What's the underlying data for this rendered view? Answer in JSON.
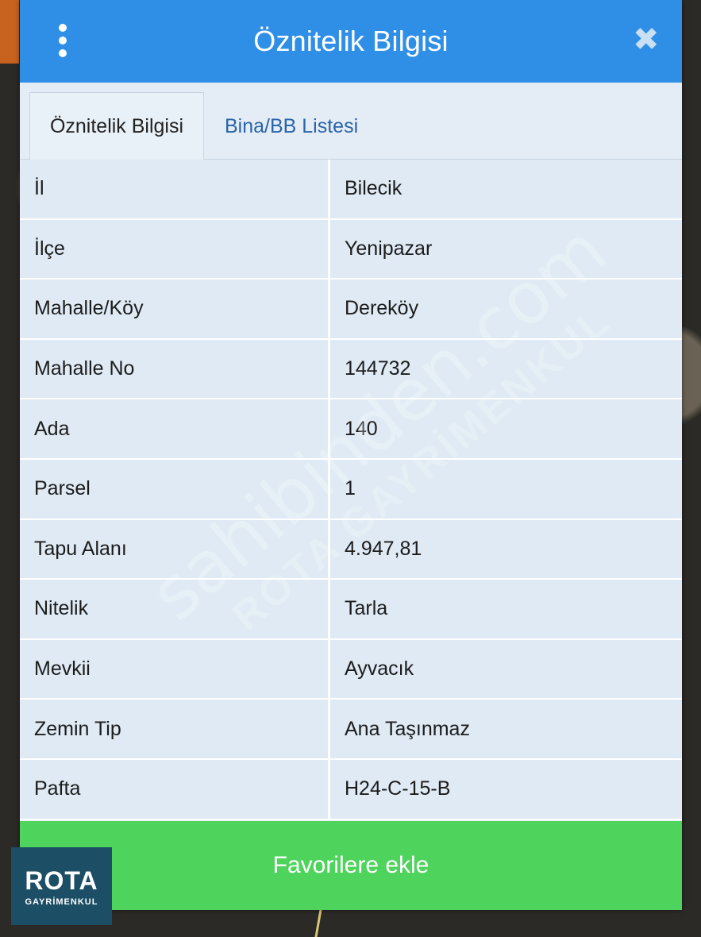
{
  "header": {
    "title": "Öznitelik Bilgisi",
    "menu_icon": "more-vertical-icon",
    "close_icon": "close-icon",
    "close_glyph": "✖"
  },
  "tabs": [
    {
      "label": "Öznitelik Bilgisi",
      "active": true
    },
    {
      "label": "Bina/BB Listesi",
      "active": false
    }
  ],
  "table": {
    "rows": [
      {
        "key": "İl",
        "value": "Bilecik"
      },
      {
        "key": "İlçe",
        "value": "Yenipazar"
      },
      {
        "key": "Mahalle/Köy",
        "value": "Dereköy"
      },
      {
        "key": "Mahalle No",
        "value": "144732"
      },
      {
        "key": "Ada",
        "value": "140"
      },
      {
        "key": "Parsel",
        "value": "1"
      },
      {
        "key": "Tapu Alanı",
        "value": "4.947,81"
      },
      {
        "key": "Nitelik",
        "value": "Tarla"
      },
      {
        "key": "Mevkii",
        "value": "Ayvacık"
      },
      {
        "key": "Zemin Tip",
        "value": "Ana Taşınmaz"
      },
      {
        "key": "Pafta",
        "value": "H24-C-15-B"
      }
    ]
  },
  "button": {
    "label": "Favorilere ekle"
  },
  "logo": {
    "word": "ROTA",
    "sub": "GAYRİMENKUL"
  },
  "watermarks": {
    "primary": "sahibinden.com",
    "secondary": "ROTA GAYRİMENKUL"
  },
  "colors": {
    "header": "#2f8fe6",
    "button": "#4ed35c",
    "inactive_tab_text": "#2a64a8"
  }
}
